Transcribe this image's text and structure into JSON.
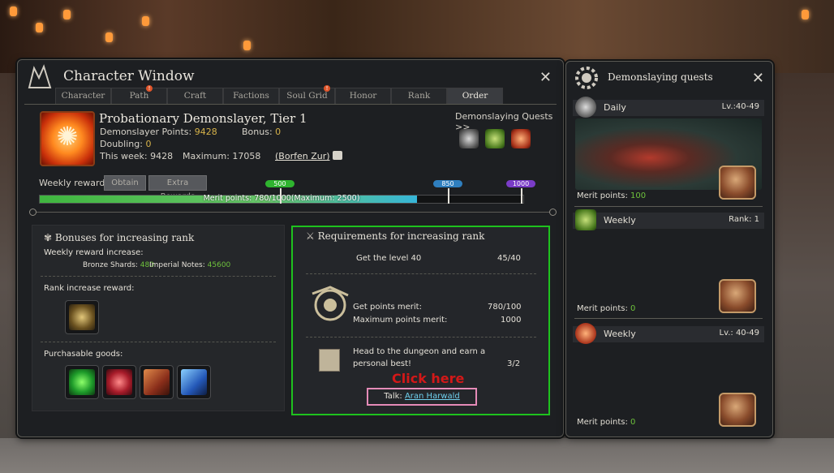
{
  "window": {
    "title": "Character Window",
    "tabs": [
      {
        "label": "Character",
        "alert": false
      },
      {
        "label": "Path",
        "alert": true
      },
      {
        "label": "Craft",
        "alert": false
      },
      {
        "label": "Factions",
        "alert": false
      },
      {
        "label": "Soul Grid",
        "alert": true
      },
      {
        "label": "Honor",
        "alert": false
      },
      {
        "label": "Rank",
        "alert": false
      },
      {
        "label": "Order",
        "alert": false,
        "active": true
      }
    ],
    "alert_glyph": "!"
  },
  "rank": {
    "title": "Probationary Demonslayer, Tier 1",
    "points_label": "Demonslayer Points:",
    "points_value": "9428",
    "bonus_label": "Bonus:",
    "bonus_value": "0",
    "doubling_label": "Doubling:",
    "doubling_value": "0",
    "week_text": "This week: 9428",
    "maximum_text": "Maximum: 17058",
    "npc_link": "(Borfen Zur)",
    "quests_label": "Demonslaying Quests >>"
  },
  "weekly": {
    "label": "Weekly reward",
    "obtain": "Obtain",
    "extra": "Extra Rewards",
    "progress_text": "Merit points: 780/1000(Maximum: 2500)",
    "progress_fraction": 0.78,
    "milestones": [
      {
        "label": "500",
        "color": "#2fb42f"
      },
      {
        "label": "850",
        "color": "#2f7fbf"
      },
      {
        "label": "1000",
        "color": "#7a3cc7"
      }
    ]
  },
  "bonuses": {
    "title": "Bonuses for increasing rank",
    "weekly_increase": "Weekly reward increase:",
    "bronze_label": "Bronze Shards:",
    "bronze_value": "480",
    "imperial_label": "Imperial Notes:",
    "imperial_value": "45600",
    "rank_reward": "Rank increase reward:",
    "purchasable": "Purchasable goods:"
  },
  "requirements": {
    "title": "Requirements for increasing rank",
    "level_text": "Get the level 40",
    "level_value": "45/40",
    "merit_text": "Get points merit:",
    "merit_value": "780/100",
    "max_merit_text": "Maximum points merit:",
    "max_merit_value": "1000",
    "dungeon_text_1": "Head to the dungeon and earn a",
    "dungeon_text_2": "personal best!",
    "dungeon_value": "3/2",
    "click_here": "Click here",
    "talk_label": "Talk:",
    "talk_npc": "Aran Harwald"
  },
  "side": {
    "title": "Demonslaying quests",
    "daily": {
      "label": "Daily",
      "level": "Lv.:40-49",
      "merit": "Merit points:",
      "merit_value": "100"
    },
    "weekly_rank": {
      "label": "Weekly",
      "level": "Rank: 1",
      "merit": "Merit points:",
      "merit_value": "0"
    },
    "weekly_lv": {
      "label": "Weekly",
      "level": "Lv.: 40-49",
      "merit": "Merit points:",
      "merit_value": "0"
    }
  },
  "icons": {
    "close": "close-icon",
    "rank_emblem": "demonslayer-emblem-icon",
    "colors": {
      "accent_gold": "#d6b24a",
      "value_green": "#6ec23c",
      "highlight_green": "#1ec21e",
      "click_red": "#d31818",
      "talk_border": "#e58bb8"
    }
  }
}
